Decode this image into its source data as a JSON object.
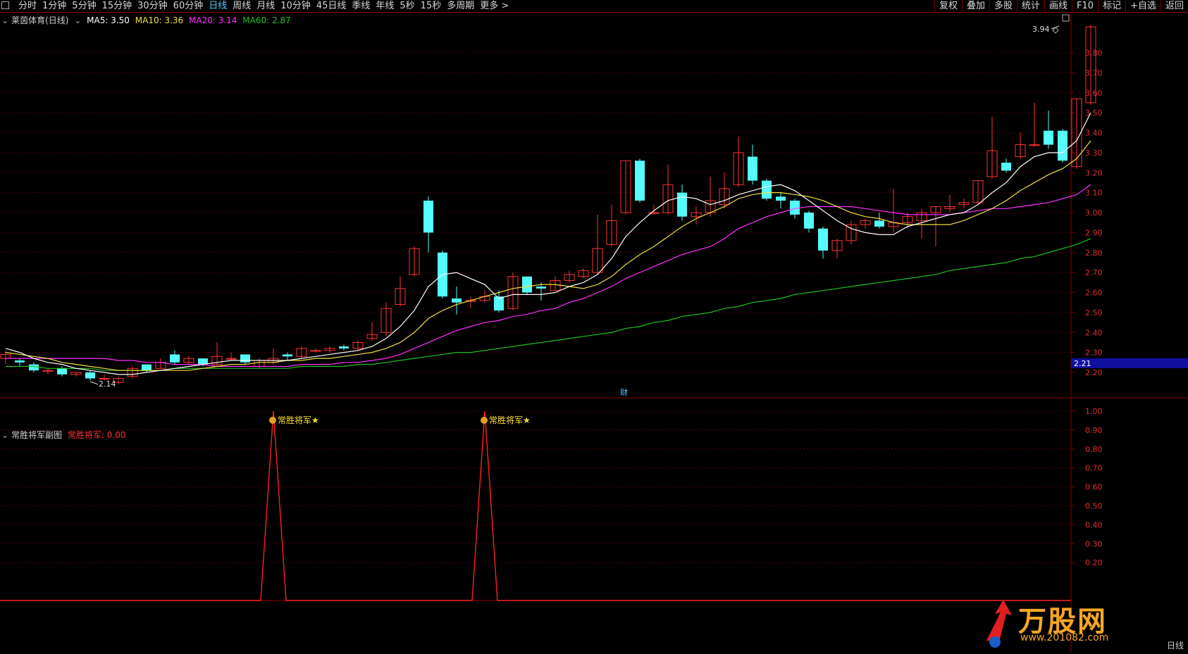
{
  "topbar": {
    "periods": [
      "分时",
      "1分钟",
      "5分钟",
      "15分钟",
      "30分钟",
      "60分钟",
      "日线",
      "周线",
      "月线",
      "10分钟",
      "45日线",
      "季线",
      "年线",
      "5秒",
      "15秒",
      "多周期",
      "更多 >"
    ],
    "active_period": "日线",
    "tools": [
      "复权",
      "叠加",
      "多股",
      "统计",
      "画线",
      "F10",
      "标记",
      "+自选",
      "返回"
    ]
  },
  "main_legend": {
    "title": "莱茵体育(日线)",
    "ma5": "MA5: 3.50",
    "ma10": "MA10: 3.36",
    "ma20": "MA20: 3.14",
    "ma60": "MA60: 2.87"
  },
  "sub_legend": {
    "title": "常胜将军副图",
    "value": "常胜将军: 0.00"
  },
  "signals": [
    "常胜将军★",
    "常胜将军★"
  ],
  "price_labels": {
    "high": "3.94",
    "low": "2.14",
    "current": "2.21",
    "fin": "财"
  },
  "colors": {
    "up": "#ff3232",
    "down": "#54fcfc",
    "ma5": "#ffffff",
    "ma10": "#f0e040",
    "ma20": "#ff30ff",
    "ma60": "#20c020",
    "grid": "#8a0000"
  },
  "logo": {
    "text": "万股网",
    "url": "www.201082.com"
  },
  "bottom_right": "日线",
  "chart_data": {
    "type": "candlestick",
    "price_axis": {
      "min": 2.14,
      "max": 3.94,
      "ticks": [
        "3.80",
        "3.70",
        "3.60",
        "3.50",
        "3.40",
        "3.30",
        "3.20",
        "3.10",
        "3.00",
        "2.90",
        "2.80",
        "2.70",
        "2.60",
        "2.50",
        "2.40",
        "2.30",
        "2.20"
      ]
    },
    "indicator_axis": {
      "ticks": [
        "1.00",
        "0.90",
        "0.80",
        "0.70",
        "0.60",
        "0.50",
        "0.40",
        "0.30",
        "0.20"
      ]
    },
    "candles": [
      [
        2.27,
        2.29,
        2.24,
        2.31
      ],
      [
        2.26,
        2.25,
        2.23,
        2.27
      ],
      [
        2.24,
        2.21,
        2.2,
        2.25
      ],
      [
        2.21,
        2.21,
        2.19,
        2.22
      ],
      [
        2.22,
        2.19,
        2.18,
        2.23
      ],
      [
        2.19,
        2.2,
        2.18,
        2.2
      ],
      [
        2.2,
        2.17,
        2.16,
        2.21
      ],
      [
        2.17,
        2.17,
        2.16,
        2.19
      ],
      [
        2.15,
        2.17,
        2.14,
        2.18
      ],
      [
        2.18,
        2.22,
        2.17,
        2.23
      ],
      [
        2.24,
        2.21,
        2.2,
        2.24
      ],
      [
        2.22,
        2.25,
        2.22,
        2.27
      ],
      [
        2.29,
        2.25,
        2.24,
        2.31
      ],
      [
        2.25,
        2.27,
        2.24,
        2.28
      ],
      [
        2.27,
        2.24,
        2.23,
        2.27
      ],
      [
        2.24,
        2.28,
        2.23,
        2.35
      ],
      [
        2.27,
        2.27,
        2.26,
        2.3
      ],
      [
        2.29,
        2.25,
        2.24,
        2.29
      ],
      [
        2.23,
        2.26,
        2.22,
        2.27
      ],
      [
        2.25,
        2.27,
        2.24,
        2.32
      ],
      [
        2.29,
        2.28,
        2.26,
        2.3
      ],
      [
        2.28,
        2.32,
        2.27,
        2.33
      ],
      [
        2.31,
        2.31,
        2.3,
        2.32
      ],
      [
        2.31,
        2.32,
        2.3,
        2.33
      ],
      [
        2.33,
        2.32,
        2.31,
        2.34
      ],
      [
        2.32,
        2.35,
        2.31,
        2.36
      ],
      [
        2.37,
        2.39,
        2.36,
        2.45
      ],
      [
        2.4,
        2.52,
        2.38,
        2.55
      ],
      [
        2.54,
        2.62,
        2.53,
        2.68
      ],
      [
        2.69,
        2.82,
        2.68,
        2.83
      ],
      [
        3.06,
        2.9,
        2.8,
        3.08
      ],
      [
        2.8,
        2.58,
        2.57,
        2.81
      ],
      [
        2.57,
        2.55,
        2.49,
        2.63
      ],
      [
        2.56,
        2.56,
        2.52,
        2.58
      ],
      [
        2.56,
        2.58,
        2.55,
        2.61
      ],
      [
        2.58,
        2.51,
        2.5,
        2.61
      ],
      [
        2.52,
        2.68,
        2.51,
        2.7
      ],
      [
        2.68,
        2.6,
        2.59,
        2.68
      ],
      [
        2.63,
        2.62,
        2.56,
        2.65
      ],
      [
        2.61,
        2.66,
        2.61,
        2.68
      ],
      [
        2.66,
        2.69,
        2.65,
        2.71
      ],
      [
        2.68,
        2.71,
        2.67,
        2.72
      ],
      [
        2.7,
        2.82,
        2.69,
        2.99
      ],
      [
        2.84,
        2.96,
        2.83,
        3.04
      ],
      [
        3.0,
        3.26,
        2.99,
        3.26
      ],
      [
        3.26,
        3.06,
        3.05,
        3.27
      ],
      [
        3.0,
        3.0,
        2.99,
        3.04
      ],
      [
        3.0,
        3.14,
        2.99,
        3.24
      ],
      [
        3.1,
        2.98,
        2.96,
        3.14
      ],
      [
        2.98,
        3.0,
        2.94,
        3.03
      ],
      [
        3.0,
        3.06,
        2.98,
        3.18
      ],
      [
        3.04,
        3.12,
        3.02,
        3.2
      ],
      [
        3.14,
        3.3,
        3.13,
        3.38
      ],
      [
        3.28,
        3.16,
        3.14,
        3.34
      ],
      [
        3.16,
        3.07,
        3.06,
        3.17
      ],
      [
        3.08,
        3.06,
        3.02,
        3.1
      ],
      [
        3.06,
        2.99,
        2.97,
        3.07
      ],
      [
        3.0,
        2.92,
        2.9,
        3.01
      ],
      [
        2.92,
        2.81,
        2.77,
        2.93
      ],
      [
        2.81,
        2.86,
        2.77,
        2.87
      ],
      [
        2.86,
        2.94,
        2.84,
        2.96
      ],
      [
        2.94,
        2.96,
        2.92,
        2.97
      ],
      [
        2.96,
        2.93,
        2.92,
        3.0
      ],
      [
        2.93,
        2.95,
        2.9,
        3.12
      ],
      [
        2.95,
        2.98,
        2.92,
        3.0
      ],
      [
        2.96,
        3.0,
        2.87,
        3.02
      ],
      [
        3.0,
        3.03,
        2.83,
        3.03
      ],
      [
        3.02,
        3.03,
        3.0,
        3.09
      ],
      [
        3.04,
        3.05,
        3.02,
        3.07
      ],
      [
        3.05,
        3.16,
        3.04,
        3.16
      ],
      [
        3.18,
        3.31,
        3.17,
        3.48
      ],
      [
        3.25,
        3.21,
        3.2,
        3.27
      ],
      [
        3.28,
        3.34,
        3.27,
        3.4
      ],
      [
        3.34,
        3.34,
        3.33,
        3.55
      ],
      [
        3.41,
        3.34,
        3.32,
        3.51
      ],
      [
        3.41,
        3.26,
        3.25,
        3.42
      ],
      [
        3.23,
        3.57,
        3.22,
        3.57
      ],
      [
        3.55,
        3.93,
        3.54,
        3.94
      ]
    ],
    "ma5": [
      2.32,
      2.3,
      2.27,
      2.25,
      2.24,
      2.22,
      2.21,
      2.2,
      2.19,
      2.19,
      2.2,
      2.21,
      2.22,
      2.23,
      2.24,
      2.25,
      2.26,
      2.26,
      2.26,
      2.26,
      2.26,
      2.27,
      2.28,
      2.29,
      2.3,
      2.31,
      2.33,
      2.37,
      2.43,
      2.51,
      2.63,
      2.69,
      2.7,
      2.67,
      2.64,
      2.57,
      2.59,
      2.59,
      2.59,
      2.6,
      2.63,
      2.65,
      2.69,
      2.77,
      2.88,
      2.95,
      3.01,
      3.06,
      3.08,
      3.07,
      3.04,
      3.06,
      3.09,
      3.11,
      3.13,
      3.14,
      3.11,
      3.06,
      3.01,
      2.96,
      2.92,
      2.9,
      2.89,
      2.89,
      2.93,
      2.95,
      2.97,
      2.99,
      3.0,
      3.04,
      3.1,
      3.15,
      3.23,
      3.28,
      3.3,
      3.3,
      3.36,
      3.5
    ],
    "ma10": [
      2.3,
      2.29,
      2.28,
      2.27,
      2.25,
      2.24,
      2.23,
      2.22,
      2.21,
      2.21,
      2.21,
      2.21,
      2.21,
      2.21,
      2.22,
      2.23,
      2.24,
      2.24,
      2.25,
      2.25,
      2.26,
      2.26,
      2.27,
      2.27,
      2.28,
      2.29,
      2.3,
      2.32,
      2.35,
      2.4,
      2.47,
      2.51,
      2.54,
      2.56,
      2.58,
      2.6,
      2.62,
      2.63,
      2.64,
      2.64,
      2.63,
      2.62,
      2.64,
      2.68,
      2.74,
      2.79,
      2.83,
      2.88,
      2.93,
      2.97,
      3.0,
      3.03,
      3.07,
      3.09,
      3.1,
      3.1,
      3.09,
      3.08,
      3.06,
      3.03,
      3.0,
      2.98,
      2.97,
      2.95,
      2.94,
      2.94,
      2.94,
      2.94,
      2.96,
      2.99,
      3.02,
      3.06,
      3.11,
      3.15,
      3.19,
      3.22,
      3.27,
      3.36
    ],
    "ma20": [
      2.27,
      2.27,
      2.27,
      2.27,
      2.27,
      2.27,
      2.27,
      2.27,
      2.26,
      2.26,
      2.25,
      2.25,
      2.24,
      2.24,
      2.24,
      2.23,
      2.23,
      2.23,
      2.23,
      2.23,
      2.23,
      2.24,
      2.24,
      2.24,
      2.25,
      2.25,
      2.26,
      2.27,
      2.29,
      2.32,
      2.35,
      2.38,
      2.41,
      2.43,
      2.45,
      2.46,
      2.48,
      2.49,
      2.51,
      2.52,
      2.55,
      2.57,
      2.6,
      2.63,
      2.67,
      2.7,
      2.73,
      2.76,
      2.79,
      2.81,
      2.83,
      2.87,
      2.92,
      2.95,
      2.98,
      3.0,
      3.02,
      3.03,
      3.03,
      3.03,
      3.03,
      3.02,
      3.01,
      3.0,
      2.99,
      2.99,
      2.99,
      2.99,
      3.0,
      3.01,
      3.02,
      3.02,
      3.03,
      3.04,
      3.05,
      3.07,
      3.09,
      3.14
    ],
    "ma60": [
      2.23,
      2.23,
      2.23,
      2.22,
      2.22,
      2.22,
      2.22,
      2.21,
      2.21,
      2.21,
      2.21,
      2.21,
      2.22,
      2.22,
      2.22,
      2.22,
      2.22,
      2.22,
      2.22,
      2.22,
      2.22,
      2.23,
      2.23,
      2.23,
      2.23,
      2.24,
      2.24,
      2.25,
      2.26,
      2.27,
      2.28,
      2.29,
      2.3,
      2.3,
      2.31,
      2.32,
      2.33,
      2.34,
      2.35,
      2.36,
      2.37,
      2.38,
      2.39,
      2.4,
      2.42,
      2.43,
      2.45,
      2.46,
      2.48,
      2.49,
      2.5,
      2.52,
      2.53,
      2.55,
      2.56,
      2.57,
      2.59,
      2.6,
      2.61,
      2.62,
      2.63,
      2.64,
      2.65,
      2.66,
      2.67,
      2.68,
      2.69,
      2.71,
      2.72,
      2.73,
      2.74,
      2.75,
      2.77,
      2.78,
      2.8,
      2.82,
      2.84,
      2.87
    ],
    "signal_days": [
      19,
      34
    ]
  }
}
